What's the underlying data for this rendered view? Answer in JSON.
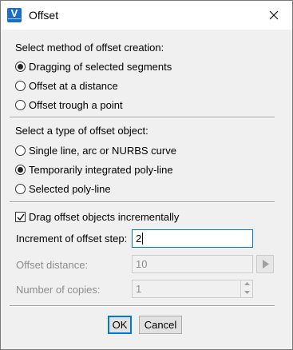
{
  "window": {
    "title": "Offset",
    "app_icon_letter": "V"
  },
  "method_section": {
    "heading": "Select method of offset creation:",
    "options": [
      {
        "label": "Dragging of selected segments",
        "checked": true
      },
      {
        "label": "Offset at a distance",
        "checked": false
      },
      {
        "label": "Offset trough a point",
        "checked": false
      }
    ]
  },
  "object_section": {
    "heading": "Select a type of offset object:",
    "options": [
      {
        "label": "Single line, arc or NURBS curve",
        "checked": false
      },
      {
        "label": "Temporarily integrated poly-line",
        "checked": true
      },
      {
        "label": "Selected poly-line",
        "checked": false
      }
    ]
  },
  "drag_incrementally": {
    "label": "Drag offset objects incrementally",
    "checked": true
  },
  "fields": {
    "increment": {
      "label": "Increment of offset step:",
      "value": "2",
      "enabled": true
    },
    "distance": {
      "label": "Offset distance:",
      "value": "10",
      "enabled": false
    },
    "copies": {
      "label": "Number of copies:",
      "value": "1",
      "enabled": false
    }
  },
  "buttons": {
    "ok": "OK",
    "cancel": "Cancel"
  },
  "icons": {
    "close": "close-icon",
    "arrow": "play-arrow-icon",
    "spin_up": "chevron-up-icon",
    "spin_down": "chevron-down-icon",
    "check": "check-icon"
  },
  "colors": {
    "focus_border": "#0078d7",
    "app_icon": "#1a6fc4",
    "dialog_bg": "#f0f0f0"
  }
}
